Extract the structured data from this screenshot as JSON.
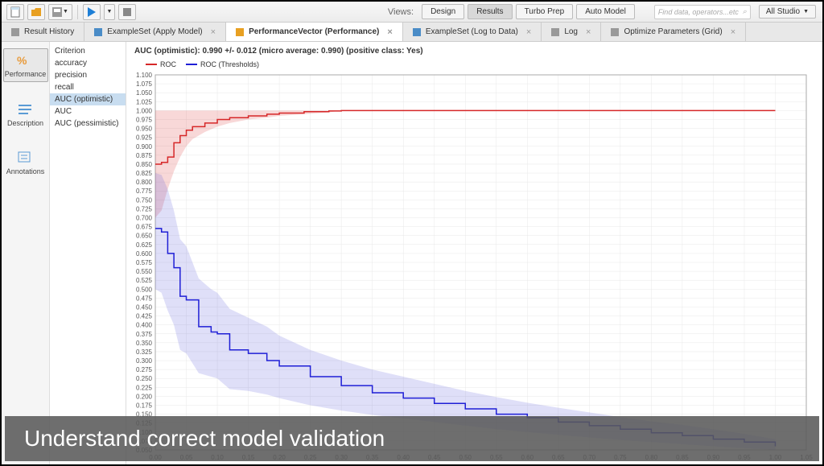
{
  "toolbar": {
    "views_label": "Views:",
    "buttons": {
      "design": "Design",
      "results": "Results",
      "turbo_prep": "Turbo Prep",
      "auto_model": "Auto Model"
    },
    "search_placeholder": "Find data, operators...etc",
    "dropdown": "All Studio"
  },
  "tabs": [
    {
      "label": "Result History",
      "icon": "gray"
    },
    {
      "label": "ExampleSet (Apply Model)",
      "icon": "blue"
    },
    {
      "label": "PerformanceVector (Performance)",
      "icon": "yellow",
      "active": true
    },
    {
      "label": "ExampleSet (Log to Data)",
      "icon": "blue"
    },
    {
      "label": "Log",
      "icon": "gray"
    },
    {
      "label": "Optimize Parameters (Grid)",
      "icon": "gray"
    }
  ],
  "sidebar": [
    {
      "label": "Performance",
      "icon": "percent",
      "active": true
    },
    {
      "label": "Description",
      "icon": "lines"
    },
    {
      "label": "Annotations",
      "icon": "annot"
    }
  ],
  "criteria": {
    "header": "Criterion",
    "items": [
      {
        "label": "accuracy"
      },
      {
        "label": "precision"
      },
      {
        "label": "recall"
      },
      {
        "label": "AUC (optimistic)",
        "selected": true
      },
      {
        "label": "AUC"
      },
      {
        "label": "AUC (pessimistic)"
      }
    ]
  },
  "chart": {
    "title": "AUC (optimistic): 0.990 +/- 0.012 (micro average: 0.990) (positive class: Yes)",
    "legend": [
      {
        "label": "ROC",
        "color": "#d62728"
      },
      {
        "label": "ROC (Thresholds)",
        "color": "#1f1fd6"
      }
    ]
  },
  "chart_data": {
    "type": "line",
    "xlabel": "",
    "ylabel": "",
    "xlim": [
      0.0,
      1.05
    ],
    "ylim": [
      0.05,
      1.1
    ],
    "x_ticks": [
      0.0,
      0.05,
      0.1,
      0.15,
      0.2,
      0.25,
      0.3,
      0.35,
      0.4,
      0.45,
      0.5,
      0.55,
      0.6,
      0.65,
      0.7,
      0.75,
      0.8,
      0.85,
      0.9,
      0.95,
      1.0,
      1.05
    ],
    "y_ticks": [
      0.05,
      0.075,
      0.1,
      0.125,
      0.15,
      0.175,
      0.2,
      0.225,
      0.25,
      0.275,
      0.3,
      0.325,
      0.35,
      0.375,
      0.4,
      0.425,
      0.45,
      0.475,
      0.5,
      0.525,
      0.55,
      0.575,
      0.6,
      0.625,
      0.65,
      0.675,
      0.7,
      0.725,
      0.75,
      0.775,
      0.8,
      0.825,
      0.85,
      0.875,
      0.9,
      0.925,
      0.95,
      0.975,
      1.0,
      1.025,
      1.05,
      1.075,
      1.1
    ],
    "series": [
      {
        "name": "ROC",
        "color": "#d62728",
        "band_color": "rgba(214,39,40,0.18)",
        "x": [
          0.0,
          0.01,
          0.02,
          0.03,
          0.04,
          0.05,
          0.06,
          0.08,
          0.1,
          0.12,
          0.15,
          0.18,
          0.2,
          0.24,
          0.28,
          0.3,
          1.0
        ],
        "y": [
          0.85,
          0.855,
          0.87,
          0.91,
          0.93,
          0.945,
          0.955,
          0.965,
          0.975,
          0.98,
          0.985,
          0.99,
          0.993,
          0.997,
          0.999,
          1.0,
          1.0
        ],
        "y_upper": [
          1.0,
          1.0,
          1.0,
          1.0,
          1.0,
          1.0,
          1.0,
          1.0,
          1.0,
          1.0,
          1.0,
          1.0,
          1.0,
          1.0,
          1.0,
          1.0,
          1.0
        ],
        "y_lower": [
          0.7,
          0.72,
          0.78,
          0.83,
          0.87,
          0.9,
          0.92,
          0.94,
          0.955,
          0.965,
          0.975,
          0.98,
          0.985,
          0.99,
          0.995,
          1.0,
          1.0
        ]
      },
      {
        "name": "ROC (Thresholds)",
        "color": "#1f1fd6",
        "band_color": "rgba(80,80,214,0.18)",
        "x": [
          0.0,
          0.01,
          0.02,
          0.03,
          0.04,
          0.05,
          0.07,
          0.09,
          0.1,
          0.12,
          0.15,
          0.18,
          0.2,
          0.25,
          0.3,
          0.35,
          0.4,
          0.45,
          0.5,
          0.55,
          0.6,
          0.65,
          0.7,
          0.75,
          0.8,
          0.85,
          0.9,
          0.95,
          1.0
        ],
        "y": [
          0.67,
          0.66,
          0.6,
          0.56,
          0.48,
          0.47,
          0.395,
          0.38,
          0.375,
          0.33,
          0.32,
          0.3,
          0.285,
          0.255,
          0.23,
          0.21,
          0.195,
          0.18,
          0.165,
          0.15,
          0.14,
          0.128,
          0.118,
          0.108,
          0.098,
          0.09,
          0.08,
          0.072,
          0.06
        ],
        "y_upper": [
          0.825,
          0.82,
          0.78,
          0.72,
          0.64,
          0.62,
          0.53,
          0.5,
          0.49,
          0.445,
          0.42,
          0.395,
          0.37,
          0.33,
          0.3,
          0.275,
          0.255,
          0.235,
          0.215,
          0.198,
          0.182,
          0.168,
          0.155,
          0.142,
          0.13,
          0.12,
          0.108,
          0.095,
          0.08
        ],
        "y_lower": [
          0.5,
          0.49,
          0.44,
          0.4,
          0.33,
          0.32,
          0.265,
          0.255,
          0.25,
          0.22,
          0.215,
          0.205,
          0.195,
          0.175,
          0.16,
          0.148,
          0.138,
          0.128,
          0.118,
          0.108,
          0.1,
          0.092,
          0.085,
          0.078,
          0.072,
          0.066,
          0.06,
          0.055,
          0.05
        ]
      }
    ]
  },
  "caption": "Understand correct model validation"
}
